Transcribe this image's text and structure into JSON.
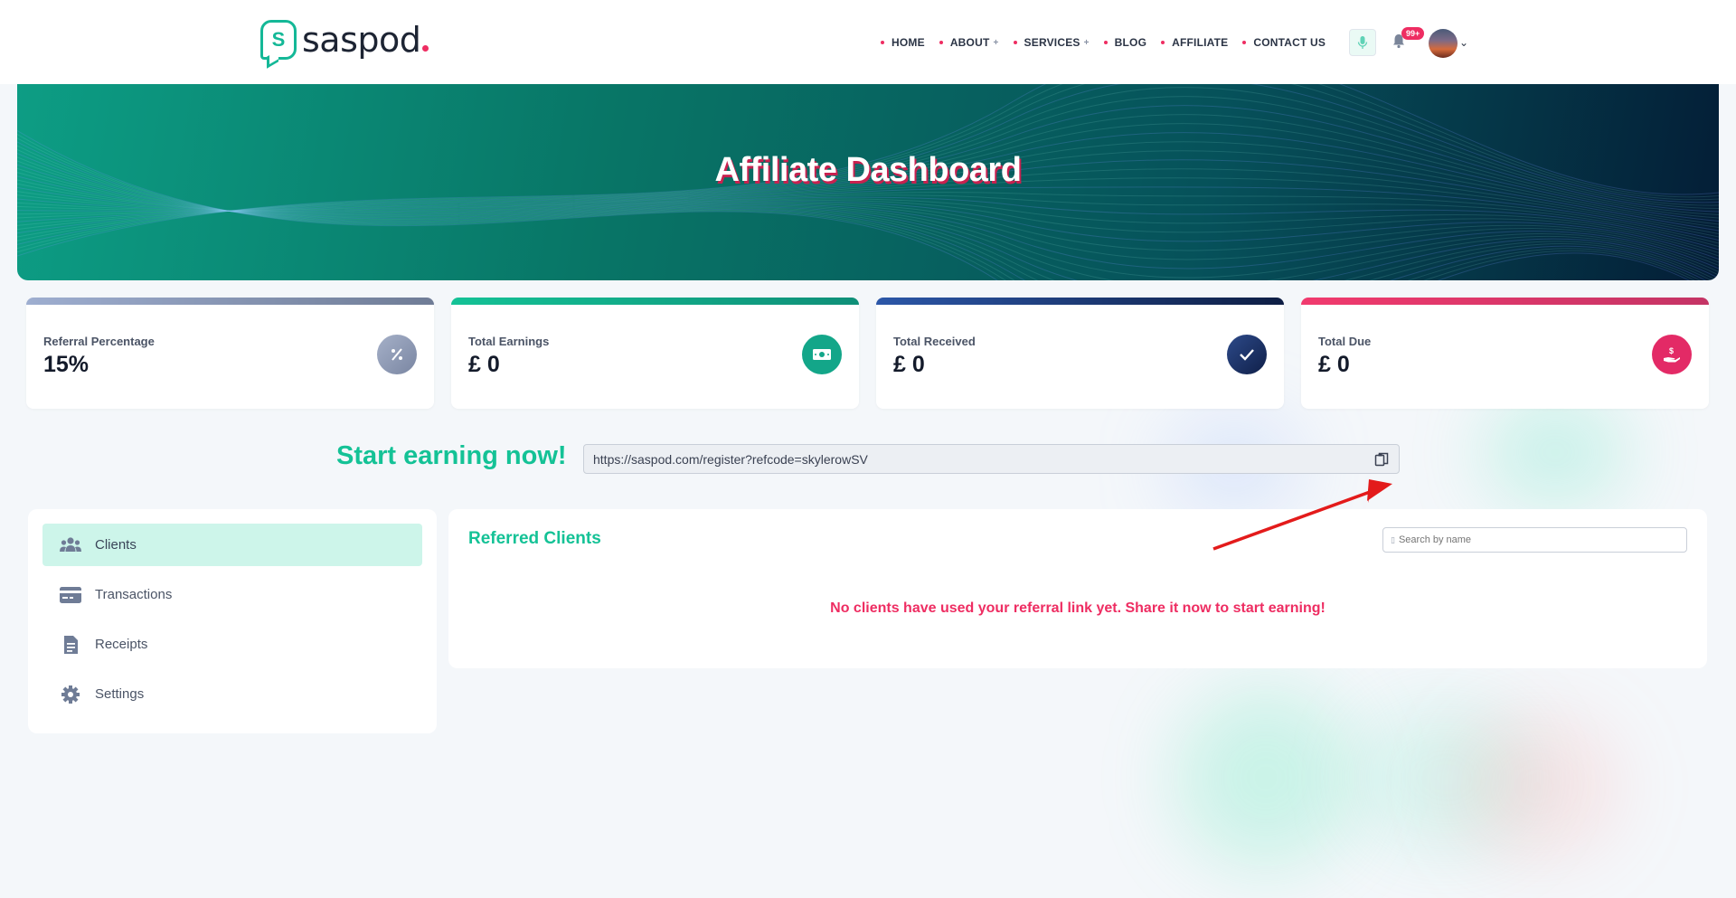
{
  "header": {
    "logo_text": "saspod",
    "logo_mark": "S",
    "nav": [
      {
        "label": "HOME",
        "has_submenu": false
      },
      {
        "label": "ABOUT",
        "has_submenu": true
      },
      {
        "label": "SERVICES",
        "has_submenu": true
      },
      {
        "label": "BLOG",
        "has_submenu": false
      },
      {
        "label": "AFFILIATE",
        "has_submenu": false
      },
      {
        "label": "CONTACT US",
        "has_submenu": false
      }
    ],
    "notification_badge": "99+",
    "icons": {
      "mic": "microphone-icon",
      "bell": "bell-icon",
      "avatar": "avatar",
      "chevron": "chevron-down-icon"
    }
  },
  "hero": {
    "title": "Affiliate Dashboard"
  },
  "stats": [
    {
      "label": "Referral Percentage",
      "value": "15%",
      "icon": "percent-icon",
      "color": "#8e9ab8"
    },
    {
      "label": "Total Earnings",
      "value": "£ 0",
      "icon": "money-icon",
      "color": "#13a689"
    },
    {
      "label": "Total Received",
      "value": "£ 0",
      "icon": "check-icon",
      "color": "#1d3468"
    },
    {
      "label": "Total Due",
      "value": "£ 0",
      "icon": "hand-money-icon",
      "color": "#e32a66"
    }
  ],
  "referral": {
    "title": "Start earning now!",
    "link": "https://saspod.com/register?refcode=skylerowSV"
  },
  "sidebar": {
    "items": [
      {
        "label": "Clients",
        "icon": "users-icon",
        "active": true
      },
      {
        "label": "Transactions",
        "icon": "credit-card-icon",
        "active": false
      },
      {
        "label": "Receipts",
        "icon": "receipt-icon",
        "active": false
      },
      {
        "label": "Settings",
        "icon": "gear-icon",
        "active": false
      }
    ]
  },
  "clients": {
    "title": "Referred Clients",
    "search_placeholder": "Search by name",
    "empty_message": "No clients have used your referral link yet. Share it now to start earning!"
  },
  "colors": {
    "accent": "#14c296",
    "brand_pink": "#ee2d62",
    "annotation_red": "#e31b1b"
  }
}
